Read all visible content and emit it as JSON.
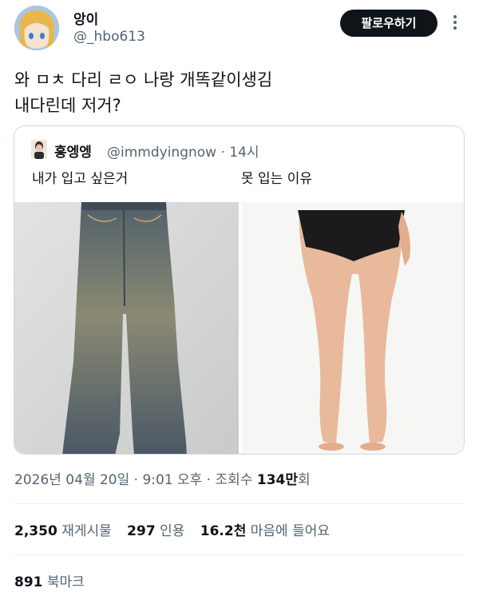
{
  "author": {
    "name": "앙이",
    "handle": "@_hbo613",
    "follow_label": "팔로우하기"
  },
  "tweet": {
    "line1": "와 ㅁㅊ 다리 ㄹㅇ 나랑 개똑같이생김",
    "line2": "내다린데 저거?"
  },
  "quote": {
    "name": "홍엥엥",
    "meta": "@immdyingnow · 14시",
    "text_left": "내가 입고 싶은거",
    "text_right": "못 입는 이유"
  },
  "meta": {
    "timestamp": "2026년 04월 20일 · 9:01 오후 · 조회수 ",
    "views": "134만",
    "views_suffix": "회"
  },
  "stats": {
    "retweets": "2,350",
    "retweets_label": "재게시물",
    "quotes": "297",
    "quotes_label": "인용",
    "likes": "16.2천",
    "likes_label": "마음에 들어요",
    "bookmarks": "891",
    "bookmarks_label": "북마크"
  }
}
